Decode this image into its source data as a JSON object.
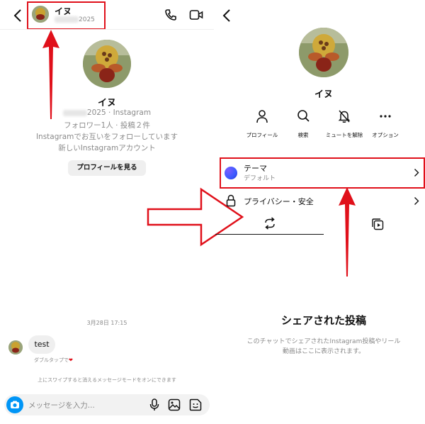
{
  "left": {
    "header": {
      "name": "イヌ",
      "handle_suffix": "2025"
    },
    "profile": {
      "name": "イヌ",
      "meta_suffix": "2025 · Instagram",
      "followers": "フォロワー1人 · 投稿２件",
      "mutual": "Instagramでお互いをフォローしています",
      "new_account": "新しいInstagramアカウント",
      "view_profile_button": "プロフィールを見る"
    },
    "chat": {
      "date_label": "3月28日 17:15",
      "message": "test",
      "double_tap_hint": "ダブルタップで",
      "swipe_hint": "上にスワイプすると消えるメッセージモードをオンにできます"
    },
    "composer": {
      "placeholder": "メッセージを入力..."
    }
  },
  "right": {
    "profile": {
      "name": "イヌ"
    },
    "actions": [
      {
        "label": "プロフィール",
        "icon": "person-icon"
      },
      {
        "label": "検索",
        "icon": "search-icon"
      },
      {
        "label": "ミュートを解除",
        "icon": "bell-off-icon"
      },
      {
        "label": "オプション",
        "icon": "more-icon"
      }
    ],
    "menu": {
      "theme_title": "テーマ",
      "theme_subtitle": "デフォルト",
      "privacy": "プライバシー・安全"
    },
    "shared": {
      "title": "シェアされた投稿",
      "description_line1": "このチャットでシェアされたInstagram投稿やリール",
      "description_line2": "動画はここに表示されます。"
    }
  },
  "colors": {
    "highlight": "#e0101a",
    "accent": "#0095f6",
    "text": "#111111",
    "muted": "#8a8a8a"
  }
}
